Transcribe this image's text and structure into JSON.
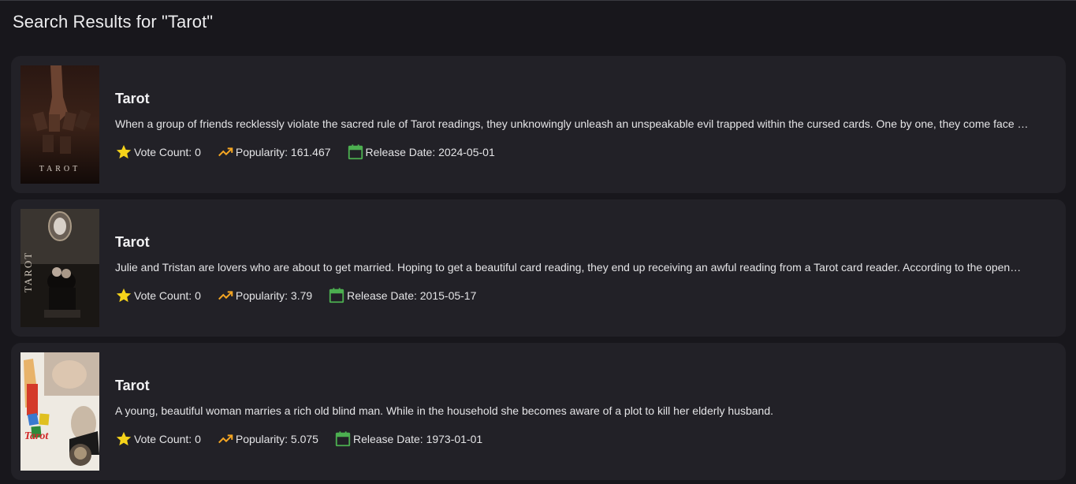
{
  "page": {
    "title": "Search Results for \"Tarot\""
  },
  "labels": {
    "vote_count": "Vote Count:",
    "popularity": "Popularity:",
    "release_date": "Release Date:"
  },
  "icons": {
    "vote": "star-icon",
    "popularity": "trending-up-icon",
    "release": "calendar-icon"
  },
  "colors": {
    "star": "#f5d31a",
    "trend": "#f5a623",
    "calendar": "#4caf50",
    "card_bg": "#222127",
    "page_bg": "#18171c"
  },
  "results": [
    {
      "title": "Tarot",
      "overview": "When a group of friends recklessly violate the sacred rule of Tarot readings, they unknowingly unleash an unspeakable evil trapped within the cursed cards. One by one, they come face …",
      "vote_count": "0",
      "popularity": "161.467",
      "release_date": "2024-05-01",
      "poster_text": "TAROT"
    },
    {
      "title": "Tarot",
      "overview": "Julie and Tristan are lovers who are about to get married. Hoping to get a beautiful card reading, they end up receiving an awful reading from a Tarot card reader. According to the open…",
      "vote_count": "0",
      "popularity": "3.79",
      "release_date": "2015-05-17",
      "poster_text": "TAROT"
    },
    {
      "title": "Tarot",
      "overview": "A young, beautiful woman marries a rich old blind man. While in the household she becomes aware of a plot to kill her elderly husband.",
      "vote_count": "0",
      "popularity": "5.075",
      "release_date": "1973-01-01",
      "poster_text": "Tarot"
    }
  ]
}
